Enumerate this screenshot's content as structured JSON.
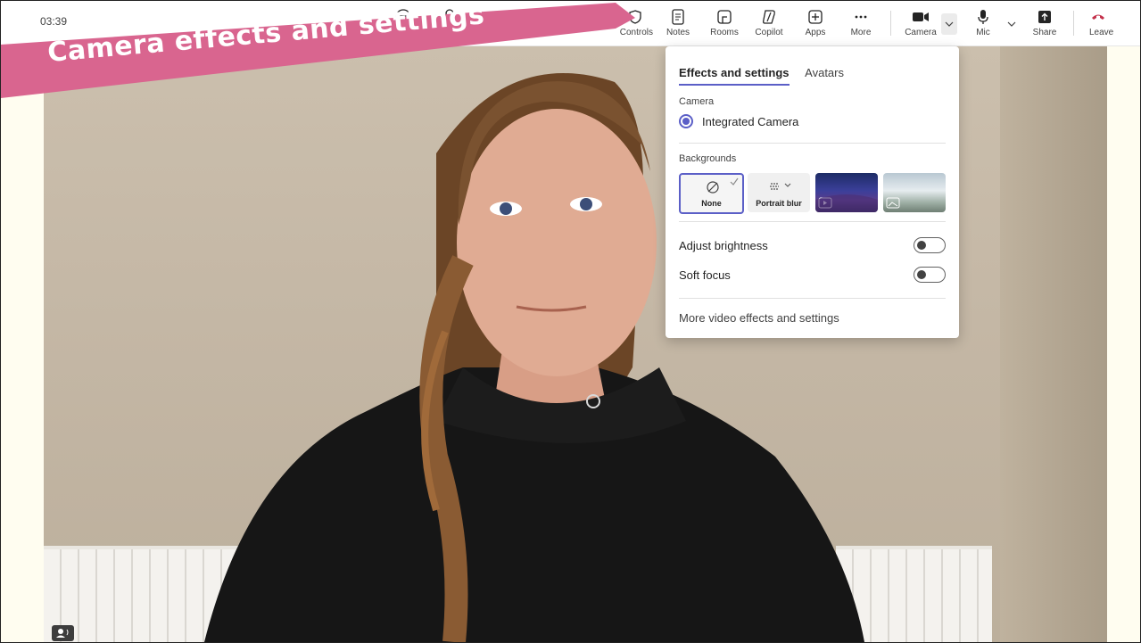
{
  "banner": {
    "title": "Camera effects and settings"
  },
  "meeting": {
    "elapsed": "03:39"
  },
  "toolbar": {
    "controls": "Controls",
    "notes": "Notes",
    "rooms": "Rooms",
    "copilot": "Copilot",
    "apps": "Apps",
    "more": "More",
    "camera": "Camera",
    "mic": "Mic",
    "share": "Share",
    "leave": "Leave"
  },
  "panel": {
    "tabs": [
      "Effects and settings",
      "Avatars"
    ],
    "camera_label": "Camera",
    "camera_selected": "Integrated Camera",
    "backgrounds_label": "Backgrounds",
    "bg_none": "None",
    "bg_blur": "Portrait blur",
    "adjust_brightness": {
      "label": "Adjust brightness",
      "on": false
    },
    "soft_focus": {
      "label": "Soft focus",
      "on": false
    },
    "more_link": "More video effects and settings"
  },
  "colors": {
    "accent": "#5b5fc7",
    "banner": "#d9658f",
    "leave": "#c4314b"
  }
}
